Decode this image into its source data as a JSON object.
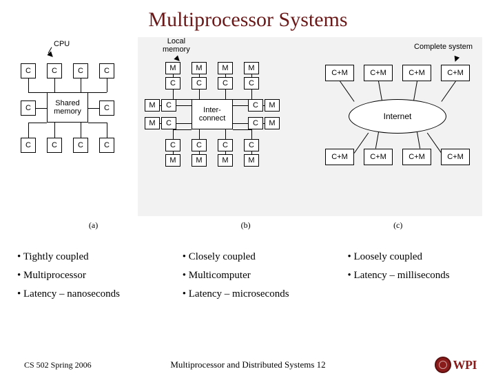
{
  "title": "Multiprocessor Systems",
  "figure": {
    "cpu_label": "CPU",
    "C": "C",
    "M": "M",
    "CM": "C+M",
    "shared_memory": "Shared\nmemory",
    "local_memory": "Local\nmemory",
    "interconnect": "Inter-\nconnect",
    "internet": "Internet",
    "complete_system": "Complete system",
    "caption_a": "(a)",
    "caption_b": "(b)",
    "caption_c": "(c)"
  },
  "columns": {
    "a": {
      "l1": "• Tightly coupled",
      "l2": "• Multiprocessor",
      "l3": "• Latency – nanoseconds"
    },
    "b": {
      "l1": "• Closely coupled",
      "l2": "• Multicomputer",
      "l3": "• Latency – microseconds"
    },
    "c": {
      "l1": "• Loosely coupled",
      "l2": "• Latency – milliseconds"
    }
  },
  "footer": {
    "left": "CS 502 Spring 2006",
    "center": "Multiprocessor and Distributed Systems  12",
    "logo_text": "WPI"
  }
}
